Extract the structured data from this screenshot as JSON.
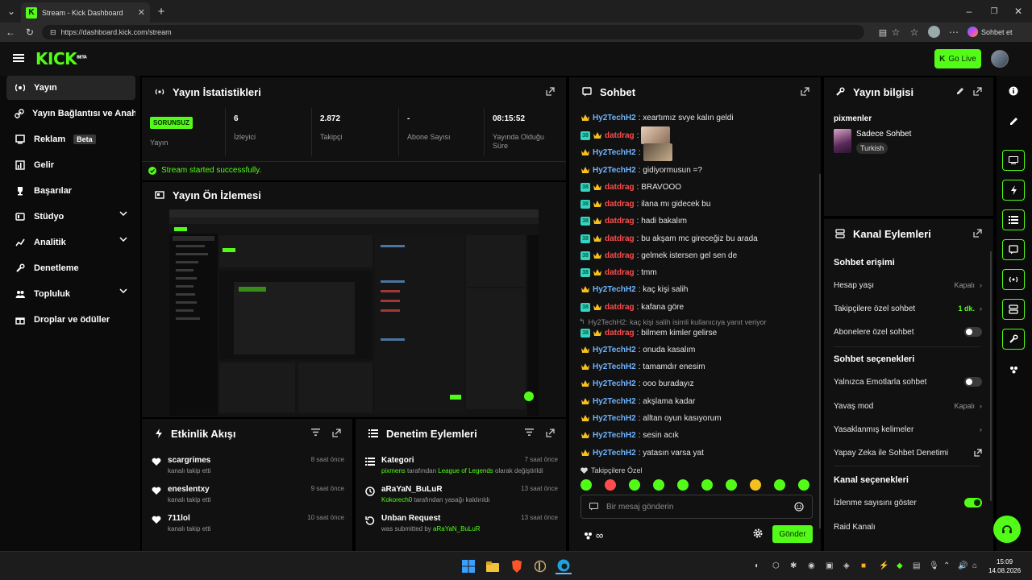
{
  "browser": {
    "tab_title": "Stream - Kick Dashboard",
    "url": "https://dashboard.kick.com/stream",
    "copilot_label": "Sohbet et"
  },
  "header": {
    "logo": "KICK",
    "logo_sup": "BETA",
    "go_live": "Go Live"
  },
  "sidebar": {
    "items": [
      {
        "label": "Yayın",
        "icon": "broadcast-icon"
      },
      {
        "label": "Yayın Bağlantısı ve Anahtarı",
        "icon": "link-icon"
      },
      {
        "label": "Reklam",
        "icon": "monitor-icon",
        "badge": "Beta"
      },
      {
        "label": "Gelir",
        "icon": "chart-icon"
      },
      {
        "label": "Başarılar",
        "icon": "trophy-icon"
      },
      {
        "label": "Stüdyo",
        "icon": "studio-icon"
      },
      {
        "label": "Analitik",
        "icon": "analytics-icon"
      },
      {
        "label": "Denetleme",
        "icon": "wrench-icon"
      },
      {
        "label": "Topluluk",
        "icon": "community-icon"
      },
      {
        "label": "Droplar ve ödüller",
        "icon": "gift-icon"
      }
    ]
  },
  "stats": {
    "title": "Yayın İstatistikleri",
    "status_badge": "SORUNSUZ",
    "status_label": "Yayın",
    "items": [
      {
        "value": "6",
        "label": "İzleyici"
      },
      {
        "value": "2.872",
        "label": "Takipçi"
      },
      {
        "value": "-",
        "label": "Abone Sayısı"
      },
      {
        "value": "08:15:52",
        "label": "Yayında Olduğu Süre"
      }
    ],
    "success_message": "Stream started successfully."
  },
  "preview": {
    "title": "Yayın Ön İzlemesi"
  },
  "activity": {
    "title": "Etkinlik Akışı",
    "items": [
      {
        "name": "scargrimes",
        "sub": "kanalı takip etti",
        "time": "8 saat önce"
      },
      {
        "name": "eneslentxy",
        "sub": "kanalı takip etti",
        "time": "9 saat önce"
      },
      {
        "name": "711lol",
        "sub": "kanalı takip etti",
        "time": "10 saat önce"
      }
    ]
  },
  "moderation": {
    "title": "Denetim Eylemleri",
    "items": [
      {
        "name": "Kategori",
        "sub_a": "pixmens",
        "sub_b": " tarafından ",
        "sub_c": "League of Legends",
        "sub_d": " olarak değiştirildi",
        "time": "7 saat önce"
      },
      {
        "name": "aRaYaN_BuLuR",
        "sub_a": "Kokorech0",
        "sub_b": " tarafından yasağı kaldırıldı",
        "sub_c": "",
        "sub_d": "",
        "time": "13 saat önce"
      },
      {
        "name": "Unban Request",
        "sub_a": "",
        "sub_b": "was submitted by ",
        "sub_c": "aRaYaN_BuLuR",
        "sub_d": "",
        "time": "13 saat önce"
      }
    ]
  },
  "chat": {
    "title": "Sohbet",
    "messages": [
      {
        "user": "Hy2TechH2",
        "color": "blue",
        "text": ": xeartımız svye kalın geldi",
        "sub": false
      },
      {
        "user": "datdrag",
        "color": "red",
        "text": ":",
        "sub": true,
        "emote": true
      },
      {
        "user": "Hy2TechH2",
        "color": "blue",
        "text": ":",
        "sub": false,
        "emote": true
      },
      {
        "user": "Hy2TechH2",
        "color": "blue",
        "text": ": gidiyormusun =?",
        "sub": false
      },
      {
        "user": "datdrag",
        "color": "red",
        "text": ": BRAVOOO",
        "sub": true
      },
      {
        "user": "datdrag",
        "color": "red",
        "text": ": ilana mı gidecek bu",
        "sub": true
      },
      {
        "user": "datdrag",
        "color": "red",
        "text": ": hadi bakalım",
        "sub": true
      },
      {
        "user": "datdrag",
        "color": "red",
        "text": ": bu akşam mc gireceğiz bu arada",
        "sub": true
      },
      {
        "user": "datdrag",
        "color": "red",
        "text": ": gelmek istersen gel sen de",
        "sub": true
      },
      {
        "user": "datdrag",
        "color": "red",
        "text": ": tmm",
        "sub": true
      },
      {
        "user": "Hy2TechH2",
        "color": "blue",
        "text": ": kaç kişi salih",
        "sub": false
      },
      {
        "user": "datdrag",
        "color": "red",
        "text": ": kafana göre",
        "sub": true
      },
      {
        "user": "datdrag",
        "color": "red",
        "text": ": bilmem kimler gelirse",
        "sub": true
      },
      {
        "user": "Hy2TechH2",
        "color": "blue",
        "text": ": onuda kasalım",
        "sub": false
      },
      {
        "user": "Hy2TechH2",
        "color": "blue",
        "text": ": tamamdır enesim",
        "sub": false
      },
      {
        "user": "Hy2TechH2",
        "color": "blue",
        "text": ": ooo buradayız",
        "sub": false
      },
      {
        "user": "Hy2TechH2",
        "color": "blue",
        "text": ": akşlama kadar",
        "sub": false
      },
      {
        "user": "Hy2TechH2",
        "color": "blue",
        "text": ": alltan oyun kasıyorum",
        "sub": false
      },
      {
        "user": "Hy2TechH2",
        "color": "blue",
        "text": ": sesin acık",
        "sub": false
      },
      {
        "user": "Hy2TechH2",
        "color": "blue",
        "text": ": yatasın varsa yat",
        "sub": false
      }
    ],
    "reply_hint": "Hy2TechH2: kaç kişi salih isimli kullanıcıya yanıt veriyor",
    "followers_only": "Takipçilere Özel",
    "input_placeholder": "Bir mesaj gönderin",
    "send_label": "Gönder",
    "badge_number": "38"
  },
  "stream_info": {
    "title": "Yayın bilgisi",
    "channel": "pixmenler",
    "stream_title": "Sadece Sohbet",
    "language_tag": "Turkish"
  },
  "channel_actions": {
    "title": "Kanal Eylemleri",
    "chat_access": "Sohbet erişimi",
    "account_age": {
      "label": "Hesap yaşı",
      "value": "Kapalı"
    },
    "followers_only": {
      "label": "Takipçilere özel sohbet",
      "value": "1 dk."
    },
    "subscribers_only": {
      "label": "Abonelere özel sohbet"
    },
    "chat_options": "Sohbet seçenekleri",
    "emotes_only": {
      "label": "Yalnızca Emotlarla sohbet"
    },
    "slow_mode": {
      "label": "Yavaş mod",
      "value": "Kapalı"
    },
    "banned_words": {
      "label": "Yasaklanmış kelimeler"
    },
    "ai_moderation": {
      "label": "Yapay Zeka ile Sohbet Denetimi"
    },
    "channel_options": "Kanal seçenekleri",
    "show_viewers": {
      "label": "İzlenme sayısını göster"
    },
    "raid": {
      "label": "Raid Kanalı"
    }
  },
  "taskbar": {
    "time": "15:09",
    "date": "14.08.2026"
  },
  "colors": {
    "accent": "#53fc18",
    "panel": "#111111",
    "page": "#000000"
  }
}
